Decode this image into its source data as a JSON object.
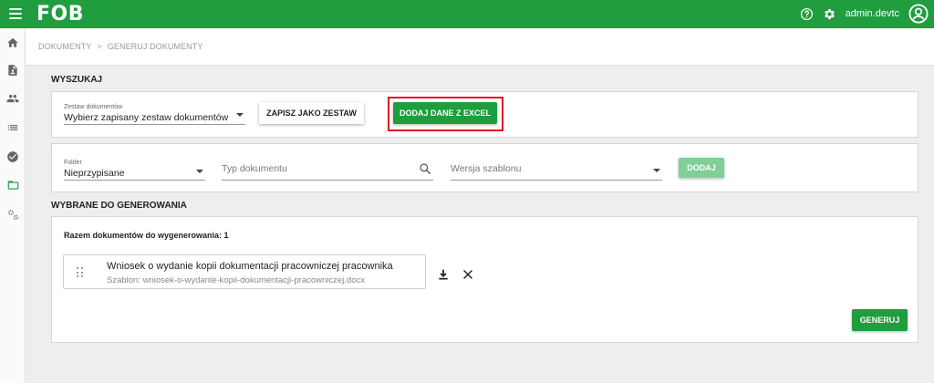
{
  "app": {
    "logo": "FOB"
  },
  "user": {
    "name": "admin.devtc"
  },
  "breadcrumb": [
    "DOKUMENTY",
    ">",
    "GENERUJ DOKUMENTY"
  ],
  "search_section": {
    "title": "WYSZUKAJ",
    "set_select": {
      "label": "Zestaw dokumentów",
      "value": "Wybierz zapisany zestaw dokumentów"
    },
    "save_set_button": "ZAPISZ JAKO ZESTAW",
    "excel_button": "DODAJ DANE Z EXCEL"
  },
  "filters": {
    "folder": {
      "label": "Folder",
      "value": "Nieprzypisane"
    },
    "doc_type": {
      "placeholder": "Typ dokumentu"
    },
    "template_version": {
      "placeholder": "Wersja szablonu"
    },
    "add_button": "DODAJ"
  },
  "selected_section": {
    "title": "WYBRANE DO GENEROWANIA",
    "total_label": "Razem dokumentów do wygenerowania: 1",
    "documents": [
      {
        "title": "Wniosek o wydanie kopii dokumentacji pracowniczej pracownika",
        "template": "Szablon: wniosek-o-wydanie-kopii-dokumentacji-pracowniczej.docx"
      }
    ],
    "generate_button": "GENERUJ"
  },
  "colors": {
    "brand": "#1f9d3f",
    "highlight": "#e0141e"
  },
  "icons": {
    "sidebar": [
      "home-icon",
      "document-icon",
      "people-icon",
      "list-icon",
      "check-circle-icon",
      "folder-open-icon",
      "settings-cogs-icon"
    ],
    "topbar": [
      "menu-icon",
      "help-icon",
      "gear-icon",
      "account-icon"
    ]
  }
}
